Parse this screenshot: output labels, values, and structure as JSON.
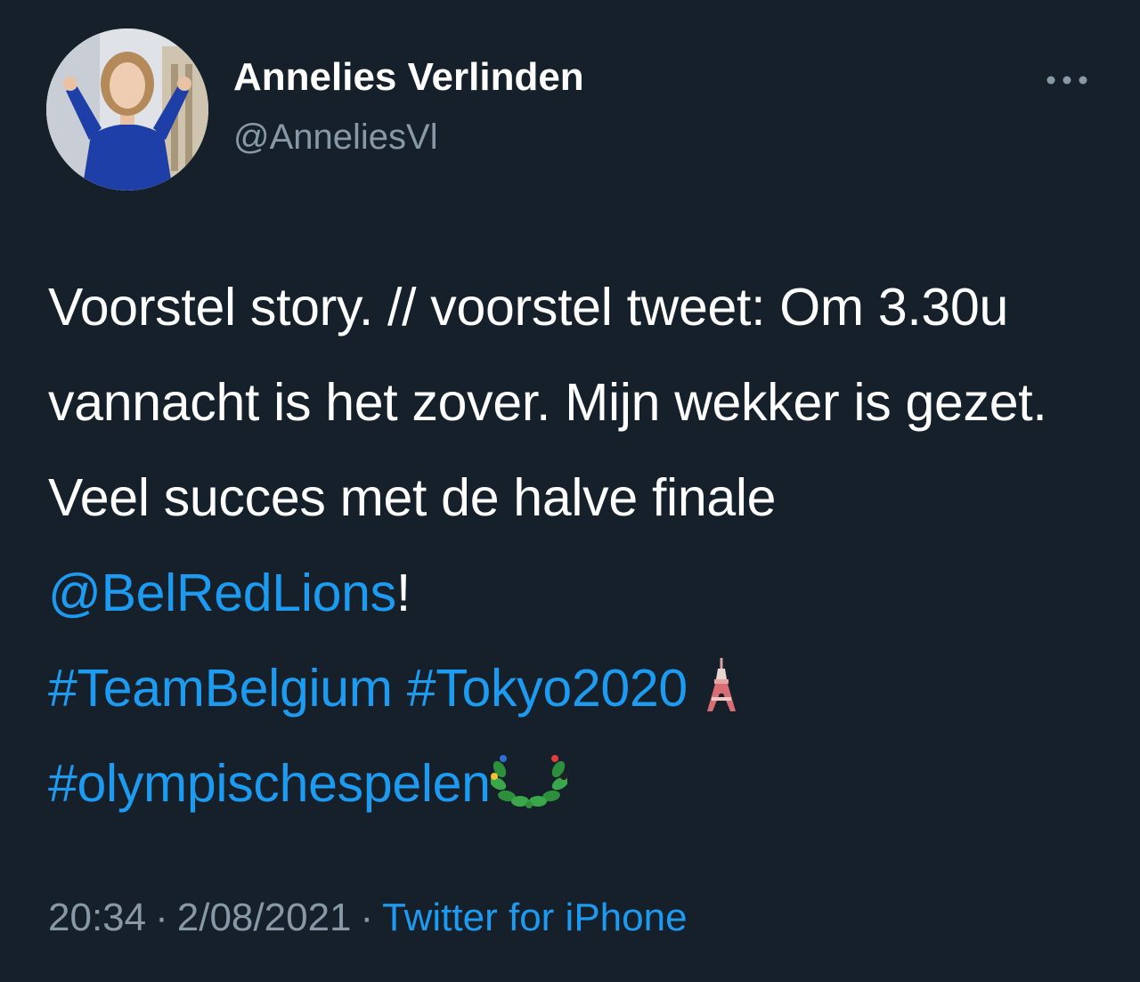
{
  "author": {
    "name": "Annelies Verlinden",
    "handle": "@AnneliesVl"
  },
  "tweet": {
    "text_part1": "Voorstel story. // voorstel tweet: Om 3.30u vannacht is het zover. Mijn wekker is gezet. Veel succes met de halve finale ",
    "mention": "@BelRedLions",
    "text_part2": "!",
    "hashtag1": "#TeamBelgium",
    "hashtag2": "#Tokyo2020",
    "emoji1": "tokyo-tower-emoji",
    "hashtag3": "#olympischespelen",
    "emoji2": "laurel-wreath-emoji"
  },
  "meta": {
    "time": "20:34",
    "separator1": "·",
    "date": "2/08/2021",
    "separator2": "·",
    "source": "Twitter for iPhone"
  },
  "colors": {
    "background": "#15202b",
    "link": "#1d9bf0",
    "secondary_text": "#8899a6"
  },
  "icons": {
    "more": "more-horizontal-icon"
  }
}
